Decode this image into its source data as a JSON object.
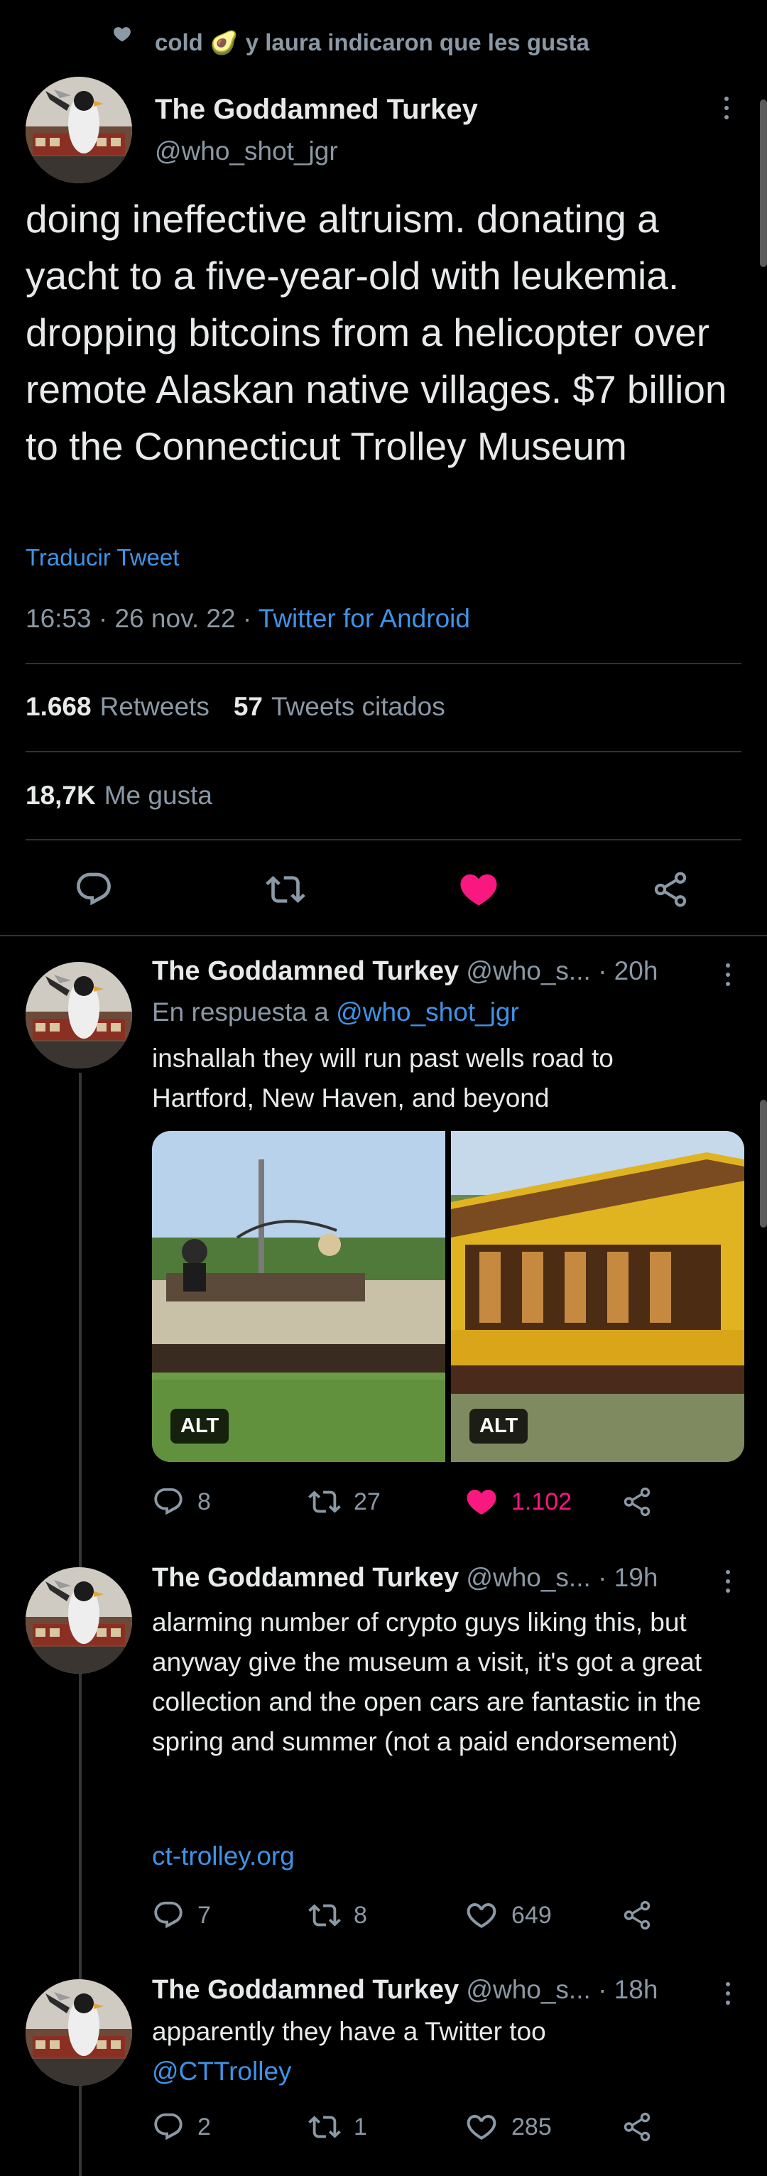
{
  "liked_by": {
    "name_1": "cold",
    "emoji": "🥑",
    "text": "y laura indicaron que les gusta"
  },
  "main_tweet": {
    "author_name": "The Goddamned Turkey",
    "author_handle": "@who_shot_jgr",
    "text": "doing ineffective altruism. donating a yacht to a five-year-old with leukemia. dropping bitcoins from a helicopter over remote Alaskan native villages. $7 billion to the Connecticut Trolley Museum",
    "translate_label": "Traducir Tweet",
    "time": "16:53",
    "date": "26 nov. 22",
    "source": "Twitter for Android",
    "retweets_count": "1.668",
    "retweets_label": "Retweets",
    "quotes_count": "57",
    "quotes_label": "Tweets citados",
    "likes_count": "18,7K",
    "likes_label": "Me gusta"
  },
  "replies": [
    {
      "author_name": "The Goddamned Turkey",
      "author_handle": "@who_s...",
      "age": "· 20h",
      "in_reply_prefix": "En respuesta a",
      "in_reply_handle": "@who_shot_jgr",
      "text": "inshallah they will run past wells road to Hartford, New Haven, and beyond",
      "alt_label": "ALT",
      "replies": "8",
      "retweets": "27",
      "likes": "1.102"
    },
    {
      "author_name": "The Goddamned Turkey",
      "author_handle": "@who_s...",
      "age": "· 19h",
      "text": "alarming number of crypto guys liking this, but anyway give the museum a visit, it's got a great collection and the open cars are fantastic in the spring and summer (not a paid endorsement)",
      "link": "ct-trolley.org",
      "replies": "7",
      "retweets": "8",
      "likes": "649"
    },
    {
      "author_name": "The Goddamned Turkey",
      "author_handle": "@who_s...",
      "age": "· 18h",
      "text": "apparently they have a Twitter too",
      "mention": "@CTTrolley",
      "replies": "2",
      "retweets": "1",
      "likes": "285"
    }
  ],
  "colors": {
    "accent": "#3f93e6",
    "like": "#f91880",
    "muted": "#8b98a5",
    "background": "#000000"
  }
}
